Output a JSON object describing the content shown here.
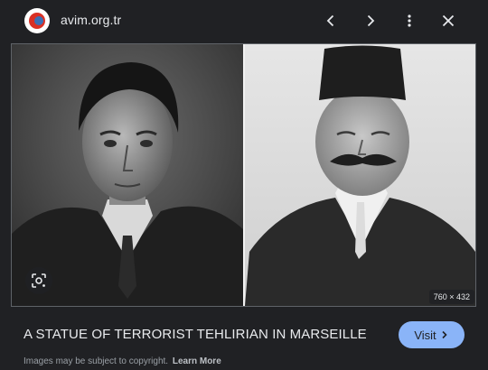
{
  "header": {
    "site_domain": "avim.org.tr",
    "icons": [
      "site-favicon",
      "chevron-left-icon",
      "chevron-right-icon",
      "more-vert-icon",
      "close-icon"
    ]
  },
  "image": {
    "dimensions_badge": "760 × 432",
    "lens_icon": "google-lens-icon"
  },
  "caption": {
    "title": "A STATUE OF TERRORIST TEHLIRIAN IN MARSEILLE",
    "visit_label": "Visit",
    "visit_icon": "chevron-right-icon"
  },
  "footer": {
    "disclaimer": "Images may be subject to copyright.",
    "learn_more": "Learn More"
  },
  "colors": {
    "background": "#202124",
    "accent_button": "#8ab4f8",
    "primary_text": "#e8eaed",
    "muted_text": "#9aa0a6"
  }
}
